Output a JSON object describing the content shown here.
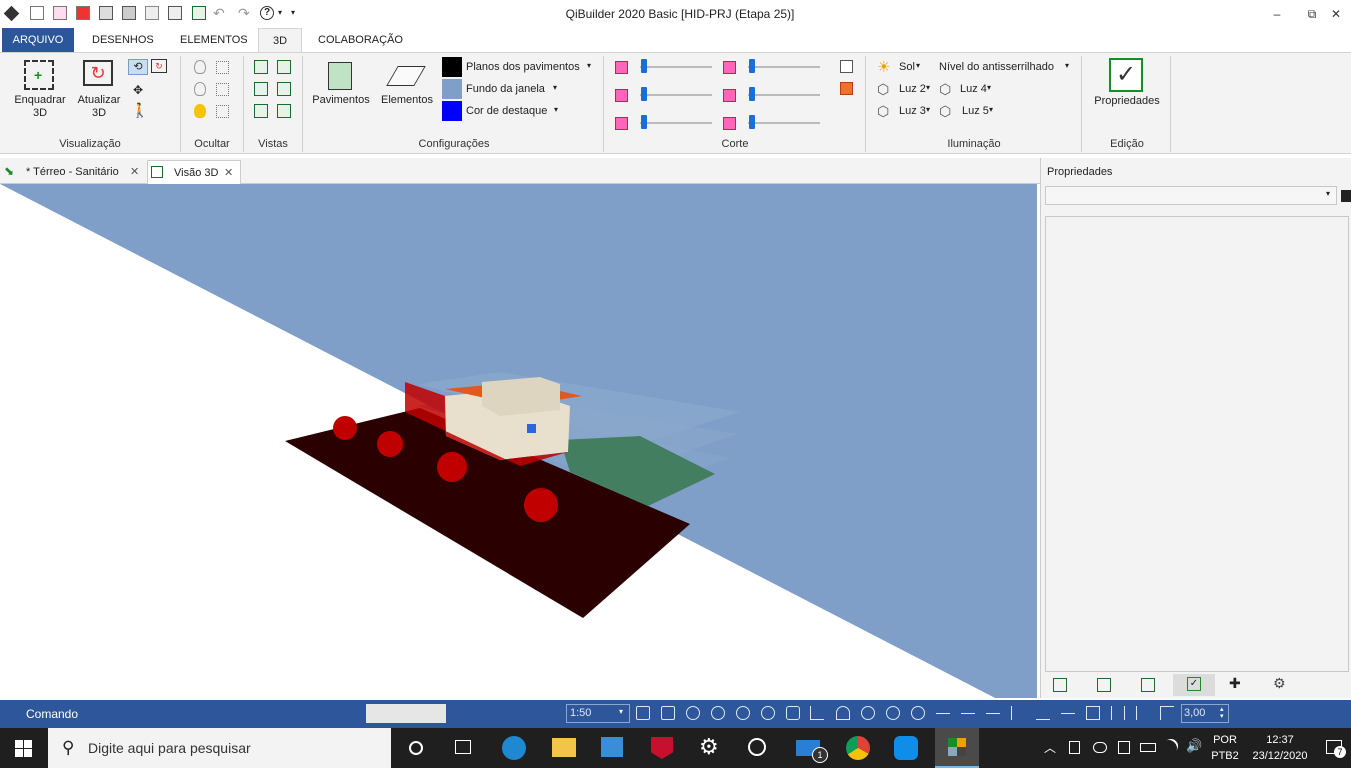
{
  "window": {
    "title": "QiBuilder 2020 Basic [HID-PRJ (Etapa 25)]",
    "minimize": "–",
    "maximize": "⧉",
    "close": "✕"
  },
  "menu": {
    "tabs": [
      "ARQUIVO",
      "DESENHOS",
      "ELEMENTOS",
      "3D",
      "COLABORAÇÃO"
    ],
    "active": "3D"
  },
  "ribbon": {
    "visualizacao": {
      "label": "Visualização",
      "enquadrar": "Enquadrar 3D",
      "atualizar": "Atualizar 3D"
    },
    "ocultar": {
      "label": "Ocultar"
    },
    "vistas": {
      "label": "Vistas"
    },
    "configuracoes": {
      "label": "Configurações",
      "pavimentos": "Pavimentos",
      "elementos": "Elementos",
      "planos": "Planos dos pavimentos",
      "fundo": "Fundo da janela",
      "cor_destaque": "Cor de destaque",
      "color_planos": "#000000",
      "color_fundo": "#7f9fc8",
      "color_destaque": "#0000ff"
    },
    "corte": {
      "label": "Corte"
    },
    "iluminacao": {
      "label": "Iluminação",
      "sol": "Sol",
      "luz2": "Luz 2",
      "luz3": "Luz 3",
      "luz4": "Luz 4",
      "luz5": "Luz 5",
      "antisserrilhado": "Nível do antisserrilhado"
    },
    "edicao": {
      "label": "Edição",
      "propriedades": "Propriedades"
    }
  },
  "doc_tabs": [
    {
      "label": "* Térreo - Sanitário"
    },
    {
      "label": "Visão 3D"
    }
  ],
  "properties_panel": {
    "title": "Propriedades"
  },
  "status": {
    "command_label": "Comando",
    "scale": "1:50",
    "value": "3,00"
  },
  "taskbar": {
    "search_placeholder": "Digite aqui para pesquisar",
    "lang": "POR",
    "layout": "PTB2",
    "time": "12:37",
    "date": "23/12/2020",
    "mail_badge": "1",
    "notif_badge": "7"
  }
}
